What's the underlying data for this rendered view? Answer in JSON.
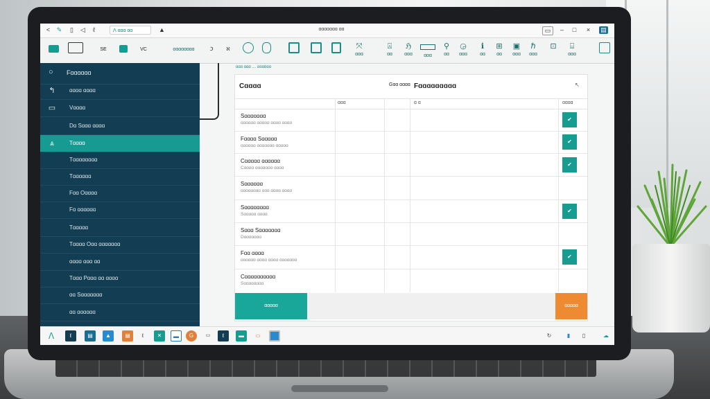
{
  "titlebar": {
    "tab_label": "ꓥ ɑɑɑ ɑɑ",
    "title": "ɑɑɑɑɑɑɑ ɑɑ",
    "back": "<",
    "icons": [
      "✎",
      "▯",
      "◁",
      "ℓ"
    ]
  },
  "ribbon": {
    "labels": [
      "SE",
      "VC",
      "ɑɑɑɑɑɑɑɑ",
      "ℑ",
      "ℵ"
    ],
    "right_labels": [
      "ɑɑɑ",
      "ɑɑ",
      "ɑɑɑ",
      "ɑɑɑ",
      "ɑɑ",
      "ɑɑɑ",
      "ɑɑ",
      "ɑɑ",
      "ɑɑɑ",
      "ɑɑɑ",
      "ɑɑɑ"
    ]
  },
  "sidebar": {
    "search_label": "Fɑɑɑɑɑɑ",
    "items": [
      {
        "label": "ɑɑɑɑ ɑɑɑɑ",
        "icon": "↰"
      },
      {
        "label": "Vɑɑɑɑ",
        "icon": "▭"
      },
      {
        "label": "Dɑ Sɑɑɑ ɑɑɑɑ",
        "icon": ""
      },
      {
        "label": "Tɑɑɑɑ",
        "icon": "⩓"
      },
      {
        "label": "Tɑɑɑɑɑɑɑɑ",
        "icon": ""
      },
      {
        "label": "Tɑɑɑɑɑɑ",
        "icon": ""
      },
      {
        "label": "Fɑɑ Oɑɑɑɑ",
        "icon": ""
      },
      {
        "label": "Fɑ ɑɑɑɑɑɑ",
        "icon": ""
      },
      {
        "label": "Tɑɑɑɑɑ",
        "icon": ""
      },
      {
        "label": "Tɑɑɑɑ Oɑɑ ɑɑɑɑɑɑɑ",
        "icon": ""
      },
      {
        "label": "ɑɑɑɑ ɑɑɑ ɑɑ",
        "icon": ""
      },
      {
        "label": "Tɑɑɑ Pɑɑɑ ɑɑ ɑɑɑɑ",
        "icon": ""
      },
      {
        "label": "ɑɑ Sɑɑɑɑɑɑɑ",
        "icon": ""
      },
      {
        "label": "ɑɑ ɑɑɑɑɑɑ",
        "icon": ""
      }
    ]
  },
  "main": {
    "breadcrumb": "ɑɑɑ ɑɑɑ … ɑɑɑɑɑɑ",
    "col1_header": "Cɑɑɑɑ",
    "col3_header": "Gɑɑ ɑɑɑɑ",
    "col4_header": "Fɑɑɑɑɑɑɑɑɑ",
    "sub_col2": "ɑɑɑ",
    "sub_col3": "ɑ ɑ",
    "sub_col4": "ɑɑɑɑ",
    "rows": [
      {
        "title": "Sɑɑɑɑɑɑɑ",
        "sub": "ɑɑɑɑɑɑ ɑɑɑɑɑ ɑɑɑɑ ɑɑɑɑ",
        "checked": true
      },
      {
        "title": "Fɑɑɑɑ Sɑɑɑɑɑ",
        "sub": "ɑɑɑɑɑɑ ɑɑɑɑɑɑɑ ɑɑɑɑɑ",
        "checked": true
      },
      {
        "title": "Cɑɑɑɑɑ ɑɑɑɑɑɑ",
        "sub": "Cɑɑɑɑ ɑɑɑɑɑɑɑ ɑɑɑɑ",
        "checked": true
      },
      {
        "title": "Sɑɑɑɑɑɑ",
        "sub": "ɑɑɑɑɑɑɑɑ ɑɑɑ ɑɑɑɑ ɑɑɑɑ",
        "checked": false
      },
      {
        "title": "Sɑɑɑɑɑɑɑɑ",
        "sub": "Sɑɑɑɑɑ ɑɑɑɑ",
        "checked": true
      },
      {
        "title": "Sɑɑɑ Sɑɑɑɑɑɑɑ",
        "sub": "Dɑɑɑɑɑɑɑ",
        "checked": false
      },
      {
        "title": "Fɑɑ ɑɑɑɑ",
        "sub": "ɑɑɑɑɑɑ ɑɑɑɑ ɑɑɑɑ ɑɑɑɑɑɑɑ",
        "checked": true
      },
      {
        "title": "Cɑɑɑɑɑɑɑɑɑɑ",
        "sub": "Sɑɑɑɑɑɑɑɑ",
        "checked": false
      }
    ],
    "primary_button": "ɑɑɑɑɑ",
    "secondary_button": "ɑɑɑɑɑ"
  },
  "colors": {
    "sidebar_bg": "#123d52",
    "accent_teal": "#179c91",
    "accent_orange": "#ee8a31"
  }
}
